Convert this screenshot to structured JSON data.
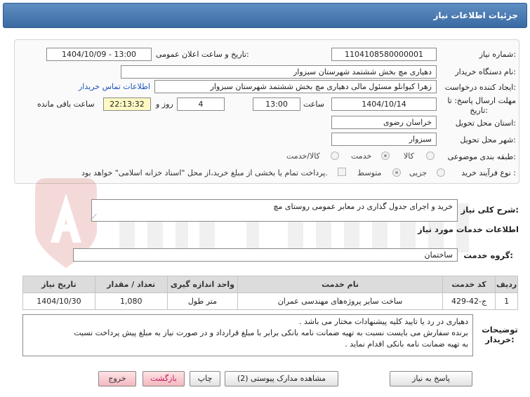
{
  "header": {
    "title": "جزئیات اطلاعات نیاز"
  },
  "form": {
    "need_number_label": "شماره نیاز:",
    "need_number": "1104108580000001",
    "announce_label": "تاریخ و ساعت اعلان عمومی:",
    "announce_value": "1404/10/09 - 13:00",
    "buyer_org_label": "نام دستگاه خریدار:",
    "buyer_org": "دهیاری مچ بخش ششتمد شهرستان سبزوار",
    "creator_label": "ایجاد کننده درخواست:",
    "creator": "زهرا کیوانلو مسئول مالی دهیاری مچ بخش ششتمد شهرستان سبزوار",
    "contact_link": "اطلاعات تماس خریدار",
    "deadline_label_1": "مهلت ارسال پاسخ: تا",
    "deadline_label_2": "تاریخ:",
    "deadline_date": "1404/10/14",
    "time_label": "ساعت",
    "deadline_time": "13:00",
    "days_value": "4",
    "days_label": "روز و",
    "remaining_time": "22:13:32",
    "remaining_label": "ساعت باقی مانده",
    "province_label": "استان محل تحویل:",
    "province": "خراسان رضوی",
    "city_label": "شهر محل تحویل:",
    "city": "سبزوار",
    "category_label": "طبقه بندی موضوعی:",
    "category_options": [
      "کالا",
      "خدمت",
      "کالا/خدمت"
    ],
    "process_label": "نوع فرآیند خرید :",
    "process_options": [
      "جزیی",
      "متوسط"
    ],
    "payment_note": "پرداخت تمام یا بخشی از مبلغ خرید،از محل \"اسناد خزانه اسلامی\" خواهد بود."
  },
  "summary": {
    "label": "شرح کلی نیاز:",
    "text": "خرید و اجرای جدول گذاری در معابر عمومی روستای مچ"
  },
  "services": {
    "section_title": "اطلاعات خدمات مورد نیاز",
    "group_label": "گروه خدمت:",
    "group_value": "ساختمان"
  },
  "table": {
    "headers": [
      "ردیف",
      "کد خدمت",
      "نام خدمت",
      "واحد اندازه گیری",
      "تعداد / مقدار",
      "تاریخ نیاز"
    ],
    "rows": [
      [
        "1",
        "ج-42-429",
        "ساخت سایر پروژه‌های مهندسی عمران",
        "متر طول",
        "1,080",
        "1404/10/30"
      ]
    ]
  },
  "notes": {
    "label_1": "توضیحات",
    "label_2": "خریدار:",
    "line_1": "دهیاری در رد یا تایید کلیه پیشنهادات مختار می باشد .",
    "line_2": "برنده سفارش می بایست نسبت به تهیه ضمانت نامه بانکی برابر با مبلغ قرارداد و در صورت نیاز به مبلغ پیش پرداخت نسبت",
    "line_3": "به تهیه ضمانت نامه بانکی اقدام نماید ."
  },
  "buttons": {
    "reply": "پاسخ به نیاز",
    "attachments": "مشاهده مدارک پیوستی (2)",
    "print": "چاپ",
    "back": "بازگشت",
    "exit": "خروج"
  },
  "colors": {
    "header": "#3a6aa3",
    "link": "#1a56b8",
    "timer_bg": "#fff9c4"
  }
}
